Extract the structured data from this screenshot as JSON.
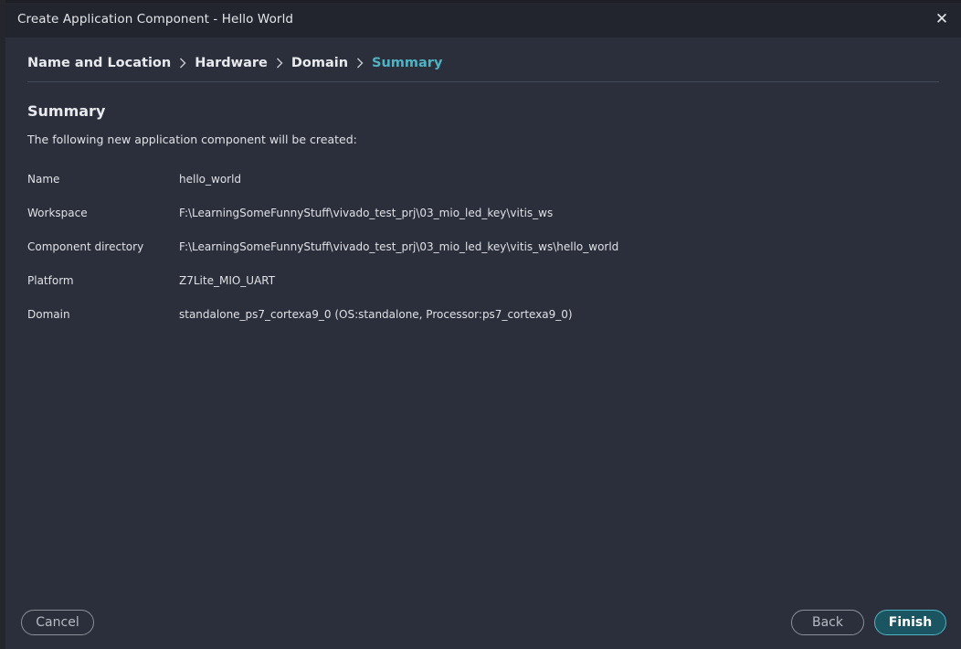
{
  "dialog": {
    "title": "Create Application Component - Hello World",
    "close_glyph": "✕"
  },
  "breadcrumb": {
    "steps": [
      {
        "label": "Name and Location"
      },
      {
        "label": "Hardware"
      },
      {
        "label": "Domain"
      },
      {
        "label": "Summary",
        "active": true
      }
    ]
  },
  "summary": {
    "heading": "Summary",
    "intro": "The following new application component will be created:",
    "rows": [
      {
        "label": "Name",
        "value": "hello_world"
      },
      {
        "label": "Workspace",
        "value": "F:\\LearningSomeFunnyStuff\\vivado_test_prj\\03_mio_led_key\\vitis_ws"
      },
      {
        "label": "Component directory",
        "value": "F:\\LearningSomeFunnyStuff\\vivado_test_prj\\03_mio_led_key\\vitis_ws\\hello_world"
      },
      {
        "label": "Platform",
        "value": "Z7Lite_MIO_UART"
      },
      {
        "label": "Domain",
        "value": "standalone_ps7_cortexa9_0 (OS:standalone, Processor:ps7_cortexa9_0)"
      }
    ]
  },
  "buttons": {
    "cancel": "Cancel",
    "back": "Back",
    "finish": "Finish"
  },
  "colors": {
    "accent": "#4fb3c4",
    "dialog_bg": "#2b2f3b",
    "titlebar_bg": "#22252e",
    "finish_bg": "#1b5561"
  },
  "icons": {
    "close": "close-icon",
    "separator": "chevron-right-icon"
  }
}
